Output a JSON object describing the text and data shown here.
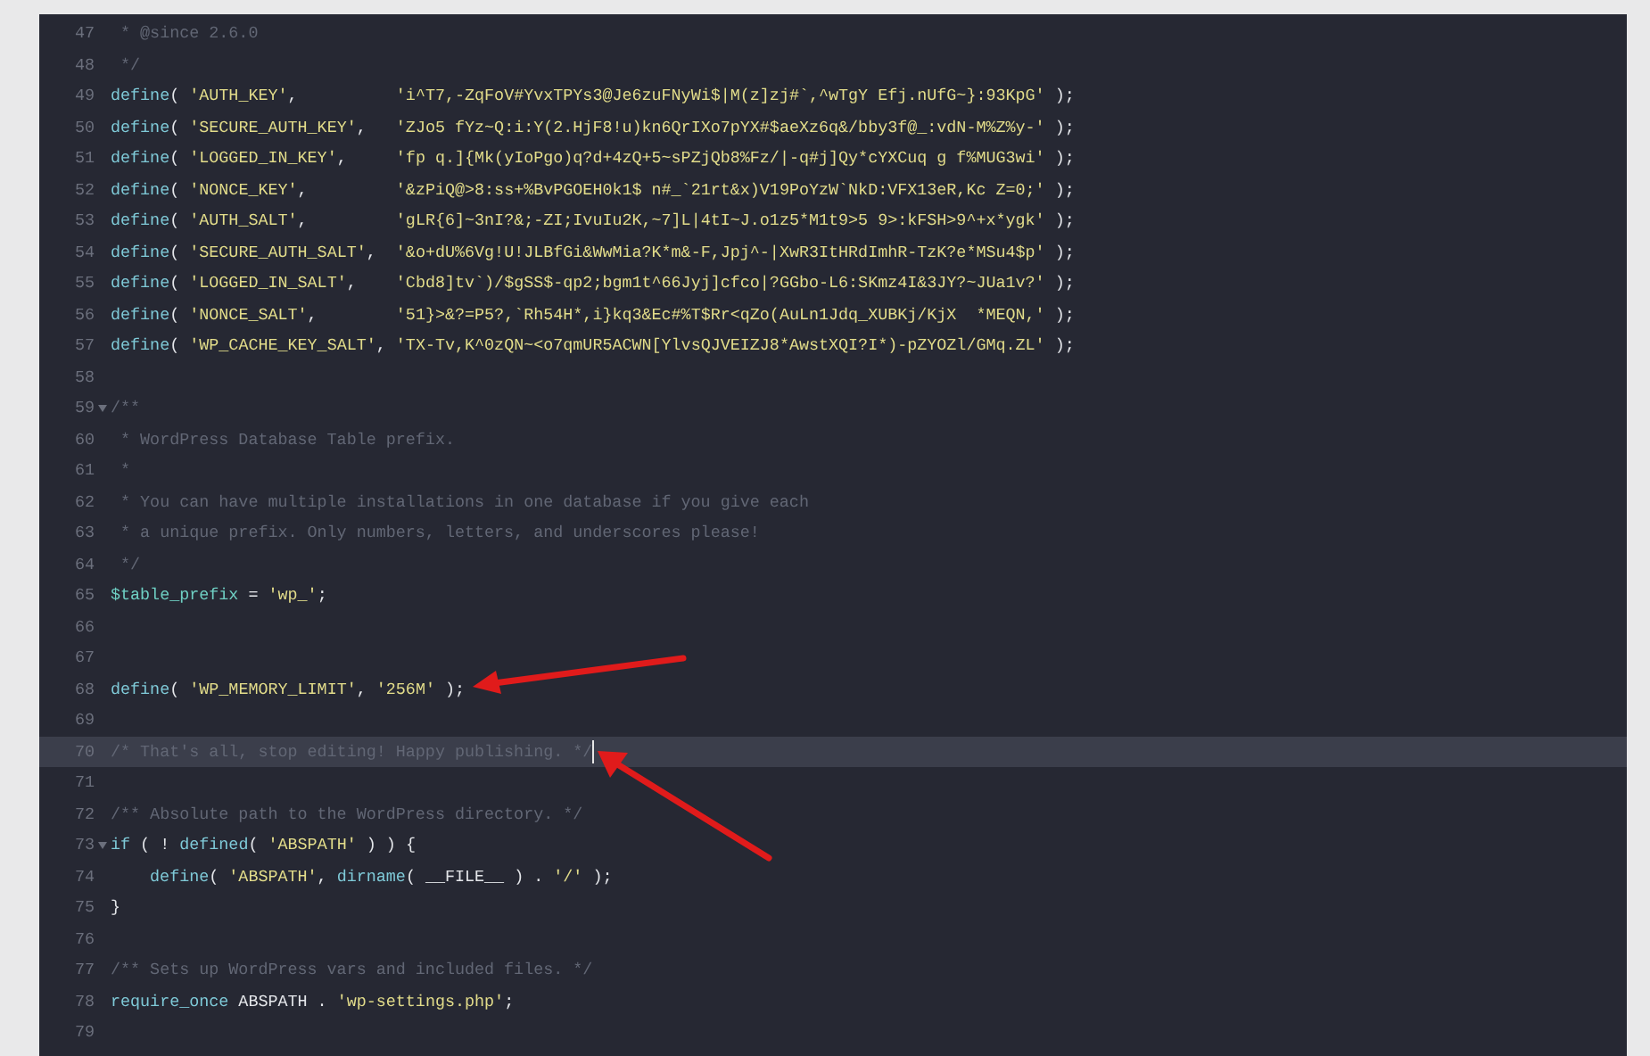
{
  "editor": {
    "lines": [
      {
        "number": "47",
        "tokens": [
          {
            "kind": "comment",
            "text": " * @since 2.6.0"
          }
        ]
      },
      {
        "number": "48",
        "tokens": [
          {
            "kind": "comment",
            "text": " */"
          }
        ]
      },
      {
        "number": "49",
        "tokens": [
          {
            "kind": "fn",
            "text": "define"
          },
          {
            "kind": "plain",
            "text": "( "
          },
          {
            "kind": "string",
            "text": "'AUTH_KEY'"
          },
          {
            "kind": "plain",
            "text": ",          "
          },
          {
            "kind": "string",
            "text": "'i^T7,-ZqFoV#YvxTPYs3@Je6zuFNyWi$|M(z]zj#`,^wTgY Efj.nUfG~}:93KpG'"
          },
          {
            "kind": "plain",
            "text": " );"
          }
        ]
      },
      {
        "number": "50",
        "tokens": [
          {
            "kind": "fn",
            "text": "define"
          },
          {
            "kind": "plain",
            "text": "( "
          },
          {
            "kind": "string",
            "text": "'SECURE_AUTH_KEY'"
          },
          {
            "kind": "plain",
            "text": ",   "
          },
          {
            "kind": "string",
            "text": "'ZJo5 fYz~Q:i:Y(2.HjF8!u)kn6QrIXo7pYX#$aeXz6q&/bby3f@_:vdN-M%Z%y-'"
          },
          {
            "kind": "plain",
            "text": " );"
          }
        ]
      },
      {
        "number": "51",
        "tokens": [
          {
            "kind": "fn",
            "text": "define"
          },
          {
            "kind": "plain",
            "text": "( "
          },
          {
            "kind": "string",
            "text": "'LOGGED_IN_KEY'"
          },
          {
            "kind": "plain",
            "text": ",     "
          },
          {
            "kind": "string",
            "text": "'fp q.]{Mk(yIoPgo)q?d+4zQ+5~sPZjQb8%Fz/|-q#j]Qy*cYXCuq g f%MUG3wi'"
          },
          {
            "kind": "plain",
            "text": " );"
          }
        ]
      },
      {
        "number": "52",
        "tokens": [
          {
            "kind": "fn",
            "text": "define"
          },
          {
            "kind": "plain",
            "text": "( "
          },
          {
            "kind": "string",
            "text": "'NONCE_KEY'"
          },
          {
            "kind": "plain",
            "text": ",         "
          },
          {
            "kind": "string",
            "text": "'&zPiQ@>8:ss+%BvPGOEH0k1$ n#_`21rt&x)V19PoYzW`NkD:VFX13eR,Kc Z=0;'"
          },
          {
            "kind": "plain",
            "text": " );"
          }
        ]
      },
      {
        "number": "53",
        "tokens": [
          {
            "kind": "fn",
            "text": "define"
          },
          {
            "kind": "plain",
            "text": "( "
          },
          {
            "kind": "string",
            "text": "'AUTH_SALT'"
          },
          {
            "kind": "plain",
            "text": ",         "
          },
          {
            "kind": "string",
            "text": "'gLR{6]~3nI?&;-ZI;IvuIu2K,~7]L|4tI~J.o1z5*M1t9>5 9>:kFSH>9^+x*ygk'"
          },
          {
            "kind": "plain",
            "text": " );"
          }
        ]
      },
      {
        "number": "54",
        "tokens": [
          {
            "kind": "fn",
            "text": "define"
          },
          {
            "kind": "plain",
            "text": "( "
          },
          {
            "kind": "string",
            "text": "'SECURE_AUTH_SALT'"
          },
          {
            "kind": "plain",
            "text": ",  "
          },
          {
            "kind": "string",
            "text": "'&o+dU%6Vg!U!JLBfGi&WwMia?K*m&-F,Jpj^-|XwR3ItHRdImhR-TzK?e*MSu4$p'"
          },
          {
            "kind": "plain",
            "text": " );"
          }
        ]
      },
      {
        "number": "55",
        "tokens": [
          {
            "kind": "fn",
            "text": "define"
          },
          {
            "kind": "plain",
            "text": "( "
          },
          {
            "kind": "string",
            "text": "'LOGGED_IN_SALT'"
          },
          {
            "kind": "plain",
            "text": ",    "
          },
          {
            "kind": "string",
            "text": "'Cbd8]tv`)/$gSS$-qp2;bgm1t^66Jyj]cfco|?GGbo-L6:SKmz4I&3JY?~JUa1v?'"
          },
          {
            "kind": "plain",
            "text": " );"
          }
        ]
      },
      {
        "number": "56",
        "tokens": [
          {
            "kind": "fn",
            "text": "define"
          },
          {
            "kind": "plain",
            "text": "( "
          },
          {
            "kind": "string",
            "text": "'NONCE_SALT'"
          },
          {
            "kind": "plain",
            "text": ",        "
          },
          {
            "kind": "string",
            "text": "'51}>&?=P5?,`Rh54H*,i}kq3&Ec#%T$Rr<qZo(AuLn1Jdq_XUBKj/KjX  *MEQN,'"
          },
          {
            "kind": "plain",
            "text": " );"
          }
        ]
      },
      {
        "number": "57",
        "tokens": [
          {
            "kind": "fn",
            "text": "define"
          },
          {
            "kind": "plain",
            "text": "( "
          },
          {
            "kind": "string",
            "text": "'WP_CACHE_KEY_SALT'"
          },
          {
            "kind": "plain",
            "text": ", "
          },
          {
            "kind": "string",
            "text": "'TX-Tv,K^0zQN~<o7qmUR5ACWN[YlvsQJVEIZJ8*AwstXQI?I*)-pZYOZl/GMq.ZL'"
          },
          {
            "kind": "plain",
            "text": " );"
          }
        ]
      },
      {
        "number": "58"
      },
      {
        "number": "59",
        "foldable": true,
        "tokens": [
          {
            "kind": "comment",
            "text": "/**"
          }
        ]
      },
      {
        "number": "60",
        "tokens": [
          {
            "kind": "comment",
            "text": " * WordPress Database Table prefix."
          }
        ]
      },
      {
        "number": "61",
        "tokens": [
          {
            "kind": "comment",
            "text": " *"
          }
        ]
      },
      {
        "number": "62",
        "tokens": [
          {
            "kind": "comment",
            "text": " * You can have multiple installations in one database if you give each"
          }
        ]
      },
      {
        "number": "63",
        "tokens": [
          {
            "kind": "comment",
            "text": " * a unique prefix. Only numbers, letters, and underscores please!"
          }
        ]
      },
      {
        "number": "64",
        "tokens": [
          {
            "kind": "comment",
            "text": " */"
          }
        ]
      },
      {
        "number": "65",
        "tokens": [
          {
            "kind": "var",
            "text": "$table_prefix"
          },
          {
            "kind": "plain",
            "text": " = "
          },
          {
            "kind": "string",
            "text": "'wp_'"
          },
          {
            "kind": "plain",
            "text": ";"
          }
        ]
      },
      {
        "number": "66"
      },
      {
        "number": "67"
      },
      {
        "number": "68",
        "arrow": true,
        "arrow_from_below": false,
        "tokens": [
          {
            "kind": "fn",
            "text": "define"
          },
          {
            "kind": "plain",
            "text": "( "
          },
          {
            "kind": "string",
            "text": "'WP_MEMORY_LIMIT'"
          },
          {
            "kind": "plain",
            "text": ", "
          },
          {
            "kind": "string",
            "text": "'256M'"
          },
          {
            "kind": "plain",
            "text": " );"
          }
        ]
      },
      {
        "number": "69"
      },
      {
        "number": "70",
        "highlighted": true,
        "arrow": true,
        "arrow_from_below": true,
        "tokens": [
          {
            "kind": "comment",
            "text": "/* That's all, stop editing! Happy publishing. */"
          }
        ]
      },
      {
        "number": "71"
      },
      {
        "number": "72",
        "tokens": [
          {
            "kind": "comment",
            "text": "/** Absolute path to the WordPress directory. */"
          }
        ]
      },
      {
        "number": "73",
        "foldable": true,
        "tokens": [
          {
            "kind": "fn",
            "text": "if"
          },
          {
            "kind": "plain",
            "text": " ( ! "
          },
          {
            "kind": "fn",
            "text": "defined"
          },
          {
            "kind": "plain",
            "text": "( "
          },
          {
            "kind": "string",
            "text": "'ABSPATH'"
          },
          {
            "kind": "plain",
            "text": " ) ) {"
          }
        ]
      },
      {
        "number": "74",
        "indented": true,
        "tokens": [
          {
            "kind": "fn",
            "text": "define"
          },
          {
            "kind": "plain",
            "text": "( "
          },
          {
            "kind": "string",
            "text": "'ABSPATH'"
          },
          {
            "kind": "plain",
            "text": ", "
          },
          {
            "kind": "fn",
            "text": "dirname"
          },
          {
            "kind": "plain",
            "text": "( __FILE__ ) . "
          },
          {
            "kind": "string",
            "text": "'/'"
          },
          {
            "kind": "plain",
            "text": " );"
          }
        ]
      },
      {
        "number": "75",
        "tokens": [
          {
            "kind": "plain",
            "text": "}"
          }
        ]
      },
      {
        "number": "76"
      },
      {
        "number": "77",
        "tokens": [
          {
            "kind": "comment",
            "text": "/** Sets up WordPress vars and included files. */"
          }
        ]
      },
      {
        "number": "78",
        "tokens": [
          {
            "kind": "fn",
            "text": "require_once"
          },
          {
            "kind": "plain",
            "text": " ABSPATH . "
          },
          {
            "kind": "string",
            "text": "'wp-settings.php'"
          },
          {
            "kind": "plain",
            "text": ";"
          }
        ]
      },
      {
        "number": "79"
      }
    ]
  }
}
